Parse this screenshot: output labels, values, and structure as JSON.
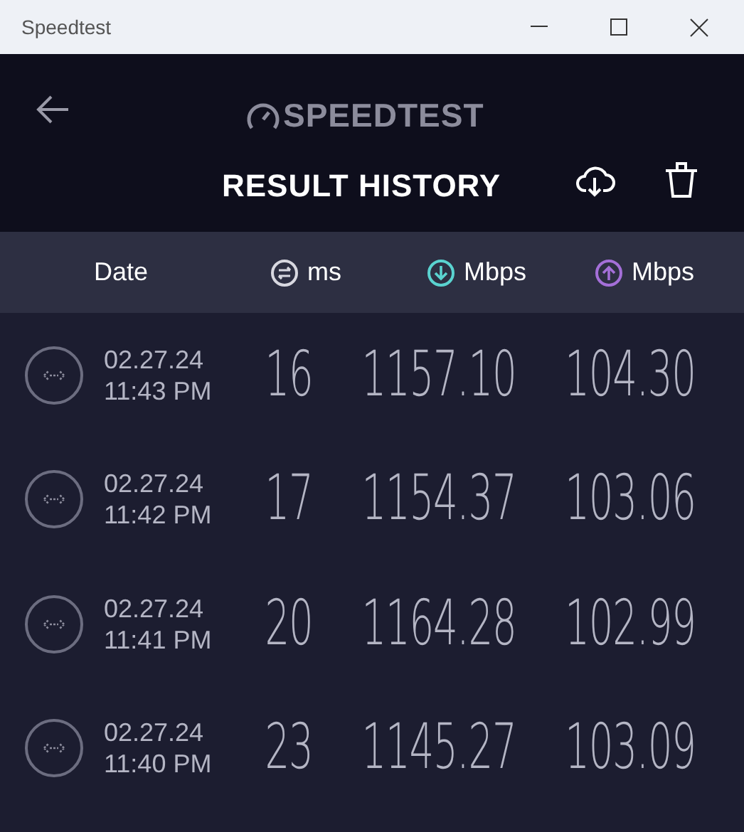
{
  "window": {
    "title": "Speedtest"
  },
  "header": {
    "logo": "SPEEDTEST",
    "title": "RESULT HISTORY"
  },
  "columns": [
    {
      "kind": "date",
      "label": "Date"
    },
    {
      "kind": "ping",
      "label": "ms"
    },
    {
      "kind": "download",
      "label": "Mbps"
    },
    {
      "kind": "upload",
      "label": "Mbps"
    }
  ],
  "rows": [
    {
      "date": "02.27.24",
      "time": "11:43 PM",
      "ping": "16",
      "download": "1157.10",
      "upload": "104.30"
    },
    {
      "date": "02.27.24",
      "time": "11:42 PM",
      "ping": "17",
      "download": "1154.37",
      "upload": "103.06"
    },
    {
      "date": "02.27.24",
      "time": "11:41 PM",
      "ping": "20",
      "download": "1164.28",
      "upload": "102.99"
    },
    {
      "date": "02.27.24",
      "time": "11:40 PM",
      "ping": "23",
      "download": "1145.27",
      "upload": "103.09"
    }
  ]
}
